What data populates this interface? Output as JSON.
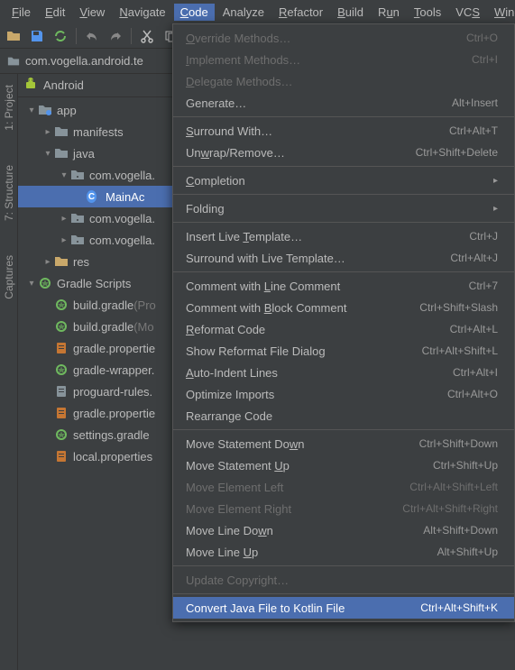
{
  "menubar": [
    {
      "label": "File",
      "u": 0
    },
    {
      "label": "Edit",
      "u": 0
    },
    {
      "label": "View",
      "u": 0
    },
    {
      "label": "Navigate",
      "u": 0
    },
    {
      "label": "Code",
      "u": 0,
      "selected": true
    },
    {
      "label": "Analyze",
      "u": -1
    },
    {
      "label": "Refactor",
      "u": 0
    },
    {
      "label": "Build",
      "u": 0
    },
    {
      "label": "Run",
      "u": 1
    },
    {
      "label": "Tools",
      "u": 0
    },
    {
      "label": "VCS",
      "u": 2
    },
    {
      "label": "Window",
      "u": 0
    }
  ],
  "breadcrumb": {
    "text": "com.vogella.android.te"
  },
  "side_tabs": {
    "project": "1: Project",
    "structure": "7: Structure",
    "captures": "Captures"
  },
  "panel_header": "Android",
  "tree": [
    {
      "depth": 0,
      "exp": "v",
      "icon": "module",
      "label": "app"
    },
    {
      "depth": 1,
      "exp": ">",
      "icon": "folder",
      "label": "manifests"
    },
    {
      "depth": 1,
      "exp": "v",
      "icon": "folder",
      "label": "java"
    },
    {
      "depth": 2,
      "exp": "v",
      "icon": "pkg",
      "label": "com.vogella."
    },
    {
      "depth": 3,
      "exp": "",
      "icon": "class",
      "label": "MainAc",
      "selected": true
    },
    {
      "depth": 2,
      "exp": ">",
      "icon": "pkg",
      "label": "com.vogella."
    },
    {
      "depth": 2,
      "exp": ">",
      "icon": "pkg",
      "label": "com.vogella."
    },
    {
      "depth": 1,
      "exp": ">",
      "icon": "res",
      "label": "res"
    },
    {
      "depth": 0,
      "exp": "v",
      "icon": "gradle",
      "label": "Gradle Scripts"
    },
    {
      "depth": 1,
      "exp": "",
      "icon": "gradle",
      "label": "build.gradle ",
      "dim": "(Pro"
    },
    {
      "depth": 1,
      "exp": "",
      "icon": "gradle",
      "label": "build.gradle ",
      "dim": "(Mo"
    },
    {
      "depth": 1,
      "exp": "",
      "icon": "prop",
      "label": "gradle.propertie"
    },
    {
      "depth": 1,
      "exp": "",
      "icon": "gradle",
      "label": "gradle-wrapper."
    },
    {
      "depth": 1,
      "exp": "",
      "icon": "txt",
      "label": "proguard-rules."
    },
    {
      "depth": 1,
      "exp": "",
      "icon": "prop",
      "label": "gradle.propertie"
    },
    {
      "depth": 1,
      "exp": "",
      "icon": "gradle",
      "label": "settings.gradle"
    },
    {
      "depth": 1,
      "exp": "",
      "icon": "prop",
      "label": "local.properties"
    }
  ],
  "dropdown": [
    {
      "label": "Override Methods…",
      "u": 0,
      "shortcut": "Ctrl+O",
      "disabled": true
    },
    {
      "label": "Implement Methods…",
      "u": 0,
      "shortcut": "Ctrl+I",
      "disabled": true
    },
    {
      "label": "Delegate Methods…",
      "u": 0,
      "disabled": true
    },
    {
      "label": "Generate…",
      "shortcut": "Alt+Insert"
    },
    {
      "sep": true
    },
    {
      "label": "Surround With…",
      "u": 0,
      "shortcut": "Ctrl+Alt+T"
    },
    {
      "label": "Unwrap/Remove…",
      "u": 2,
      "shortcut": "Ctrl+Shift+Delete"
    },
    {
      "sep": true
    },
    {
      "label": "Completion",
      "u": 0,
      "submenu": true
    },
    {
      "sep": true
    },
    {
      "label": "Folding",
      "submenu": true
    },
    {
      "sep": true
    },
    {
      "label": "Insert Live Template…",
      "u": 12,
      "shortcut": "Ctrl+J"
    },
    {
      "label": "Surround with Live Template…",
      "shortcut": "Ctrl+Alt+J"
    },
    {
      "sep": true
    },
    {
      "label": "Comment with Line Comment",
      "u": 13,
      "shortcut": "Ctrl+7"
    },
    {
      "label": "Comment with Block Comment",
      "u": 13,
      "shortcut": "Ctrl+Shift+Slash"
    },
    {
      "label": "Reformat Code",
      "u": 0,
      "shortcut": "Ctrl+Alt+L"
    },
    {
      "label": "Show Reformat File Dialog",
      "shortcut": "Ctrl+Alt+Shift+L"
    },
    {
      "label": "Auto-Indent Lines",
      "u": 0,
      "shortcut": "Ctrl+Alt+I"
    },
    {
      "label": "Optimize Imports",
      "shortcut": "Ctrl+Alt+O"
    },
    {
      "label": "Rearrange Code"
    },
    {
      "sep": true
    },
    {
      "label": "Move Statement Down",
      "u": 17,
      "shortcut": "Ctrl+Shift+Down"
    },
    {
      "label": "Move Statement Up",
      "u": 15,
      "shortcut": "Ctrl+Shift+Up"
    },
    {
      "label": "Move Element Left",
      "shortcut": "Ctrl+Alt+Shift+Left",
      "disabled": true
    },
    {
      "label": "Move Element Right",
      "shortcut": "Ctrl+Alt+Shift+Right",
      "disabled": true
    },
    {
      "label": "Move Line Down",
      "u": 12,
      "shortcut": "Alt+Shift+Down"
    },
    {
      "label": "Move Line Up",
      "u": 10,
      "shortcut": "Alt+Shift+Up"
    },
    {
      "sep": true
    },
    {
      "label": "Update Copyright…",
      "disabled": true
    },
    {
      "sep": true
    },
    {
      "label": "Convert Java File to Kotlin File",
      "shortcut": "Ctrl+Alt+Shift+K",
      "highlighted": true
    }
  ]
}
